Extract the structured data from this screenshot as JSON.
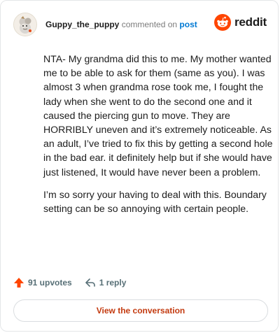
{
  "header": {
    "username": "Guppy_the_puppy",
    "action_text": "commented on",
    "post_link": "post",
    "brand": "reddit"
  },
  "comment": {
    "paragraphs": [
      "NTA- My grandma did this to me. My mother wanted me to be able to ask for them (same as you). I was almost 3 when grandma rose took me, I fought the lady when she went to do the second one and it caused the piercing gun to move. They are HORRIBLY uneven and it’s extremely noticeable. As an adult, I’ve tried to fix this by getting a second hole in the bad ear. it definitely help but if she would have just listened, It would have never been a problem.",
      "I’m so sorry your having to deal with this. Boundary setting can be so annoying with certain people."
    ]
  },
  "footer": {
    "upvotes": "91 upvotes",
    "replies": "1 reply"
  },
  "cta": {
    "label": "View the conversation"
  },
  "icons": {
    "avatar": "avatar-icon",
    "brand": "reddit-logo-icon",
    "upvote": "upvote-arrow-icon",
    "reply": "reply-arrow-icon"
  },
  "colors": {
    "reddit_orange": "#ff4500",
    "upvote_red": "#ff4500",
    "link_blue": "#0079d3",
    "cta_text": "#c33a0f"
  }
}
